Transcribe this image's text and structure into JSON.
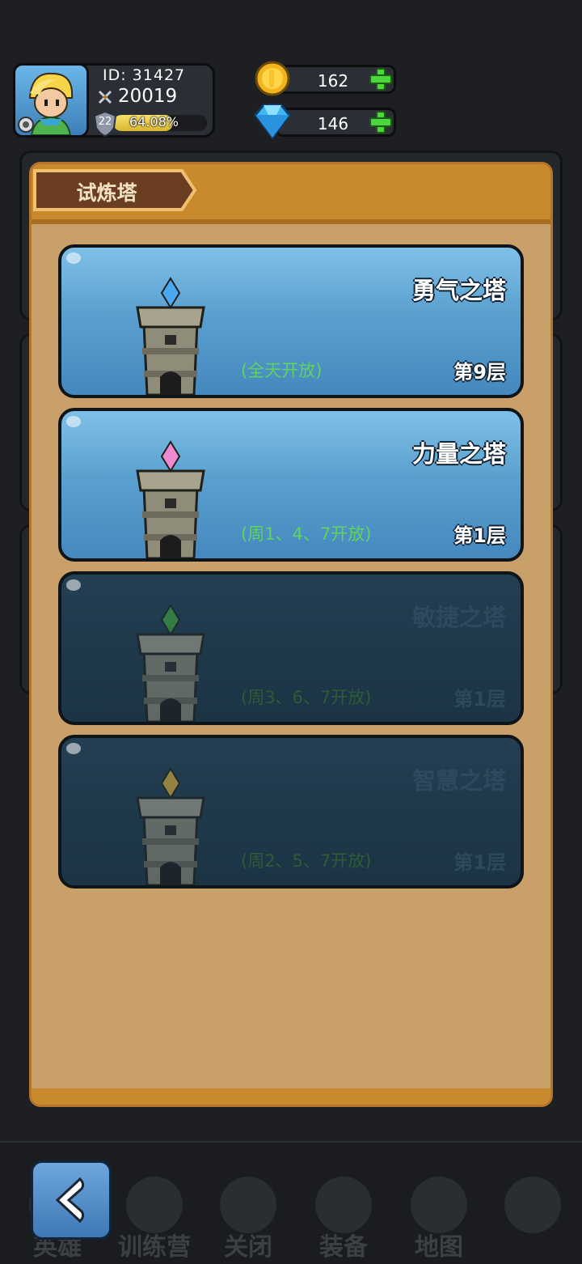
{
  "player": {
    "id_text": "ID: 31427",
    "power": "20019",
    "level": "22",
    "progress_text": "64.08%",
    "progress": 0.6408
  },
  "resources": {
    "gold": "162",
    "diamonds": "146"
  },
  "panel": {
    "title": "试炼塔"
  },
  "towers": [
    {
      "name": "勇气之塔",
      "schedule": "(全天开放)",
      "floor": "第9层",
      "locked": false,
      "gem_color": "#4aa8f0"
    },
    {
      "name": "力量之塔",
      "schedule": "(周1、4、7开放)",
      "floor": "第1层",
      "locked": false,
      "gem_color": "#f08ad0"
    },
    {
      "name": "敏捷之塔",
      "schedule": "(周3、6、7开放)",
      "floor": "第1层",
      "locked": true,
      "gem_color": "#3fa83f"
    },
    {
      "name": "智慧之塔",
      "schedule": "(周2、5、7开放)",
      "floor": "第1层",
      "locked": true,
      "gem_color": "#e0b23a"
    }
  ],
  "nav": {
    "items": [
      {
        "label": "英雄",
        "icon": "hero-icon"
      },
      {
        "label": "训练营",
        "icon": "training-camp-icon"
      },
      {
        "label": "关闭",
        "icon": "close-icon"
      },
      {
        "label": "装备",
        "icon": "equipment-icon"
      },
      {
        "label": "地图",
        "icon": "map-icon"
      },
      {
        "label": "",
        "icon": "lock-icon"
      }
    ],
    "back_icon": "back-arrow-icon"
  }
}
